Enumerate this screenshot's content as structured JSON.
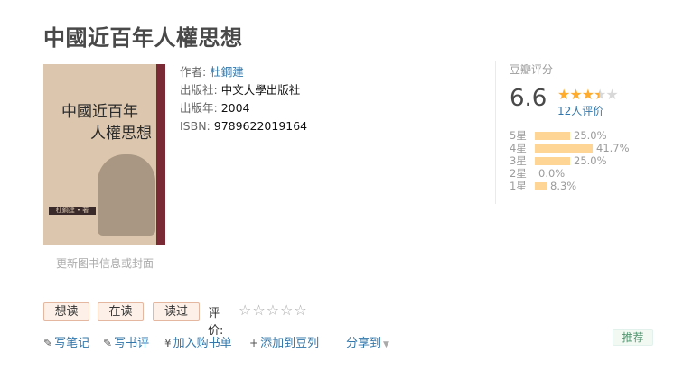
{
  "page": {
    "title": "中國近百年人權思想"
  },
  "cover": {
    "title_line1": "中國近百年",
    "title_line2": "人權思想",
    "author_band": "杜鋼建 • 著",
    "update_link": "更新图书信息或封面"
  },
  "info": {
    "author_label": "作者:",
    "author": "杜鋼建",
    "publisher_label": "出版社:",
    "publisher": "中文大學出版社",
    "year_label": "出版年:",
    "year": "2004",
    "isbn_label": "ISBN:",
    "isbn": "9789622019164"
  },
  "rating": {
    "title": "豆瓣评分",
    "score": "6.6",
    "score_value": 6.6,
    "stars_filled": 3.5,
    "votes": "12人评价",
    "distribution": [
      {
        "label": "5星",
        "percent_text": "25.0%",
        "percent": 25.0
      },
      {
        "label": "4星",
        "percent_text": "41.7%",
        "percent": 41.7
      },
      {
        "label": "3星",
        "percent_text": "25.0%",
        "percent": 25.0
      },
      {
        "label": "2星",
        "percent_text": "0.0%",
        "percent": 0.0
      },
      {
        "label": "1星",
        "percent_text": "8.3%",
        "percent": 8.3
      }
    ]
  },
  "actions": {
    "want": "想读",
    "doing": "在读",
    "done": "读过",
    "rate_label": "评价:",
    "rate_stars": "☆☆☆☆☆"
  },
  "links": {
    "write_note": "写笔记",
    "write_review": "写书评",
    "add_cart": "加入购书单",
    "add_doulist": "添加到豆列",
    "share": "分享到",
    "recommend": "推荐"
  },
  "colors": {
    "link": "#3377aa",
    "star": "#ffac2d",
    "bar": "#ffd596",
    "button_bg": "#fdf0e8"
  },
  "icons": {
    "pen": "pencil-icon",
    "yen": "yen-icon",
    "plus": "plus-icon",
    "caret": "caret-down-icon"
  }
}
